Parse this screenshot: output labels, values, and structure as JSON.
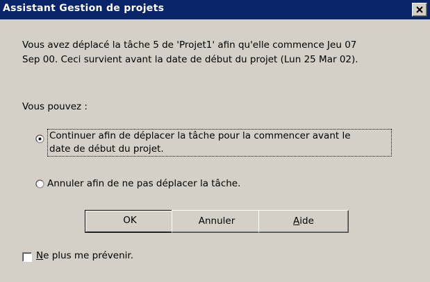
{
  "window": {
    "title": "Assistant Gestion de projets",
    "close_icon": "close-icon"
  },
  "message": {
    "line1": "Vous avez déplacé la tâche 5 de 'Projet1' afin qu'elle commence Jeu 07",
    "line2": "Sep 00. Ceci survient avant la date de début du projet (Lun 25 Mar 02)."
  },
  "prompt": "Vous pouvez :",
  "options": [
    {
      "line1": "Continuer afin de déplacer la tâche pour la commencer avant le",
      "line2": "date de début du projet.",
      "selected": true
    },
    {
      "label": "Annuler afin de ne pas déplacer la tâche.",
      "selected": false
    }
  ],
  "buttons": {
    "ok": "OK",
    "cancel": "Annuler",
    "help_accel": "A",
    "help_rest": "ide"
  },
  "checkbox": {
    "accel": "N",
    "rest": "e plus me prévenir.",
    "checked": false
  },
  "colors": {
    "titlebar": "#0a246a",
    "face": "#d4d0c8"
  }
}
